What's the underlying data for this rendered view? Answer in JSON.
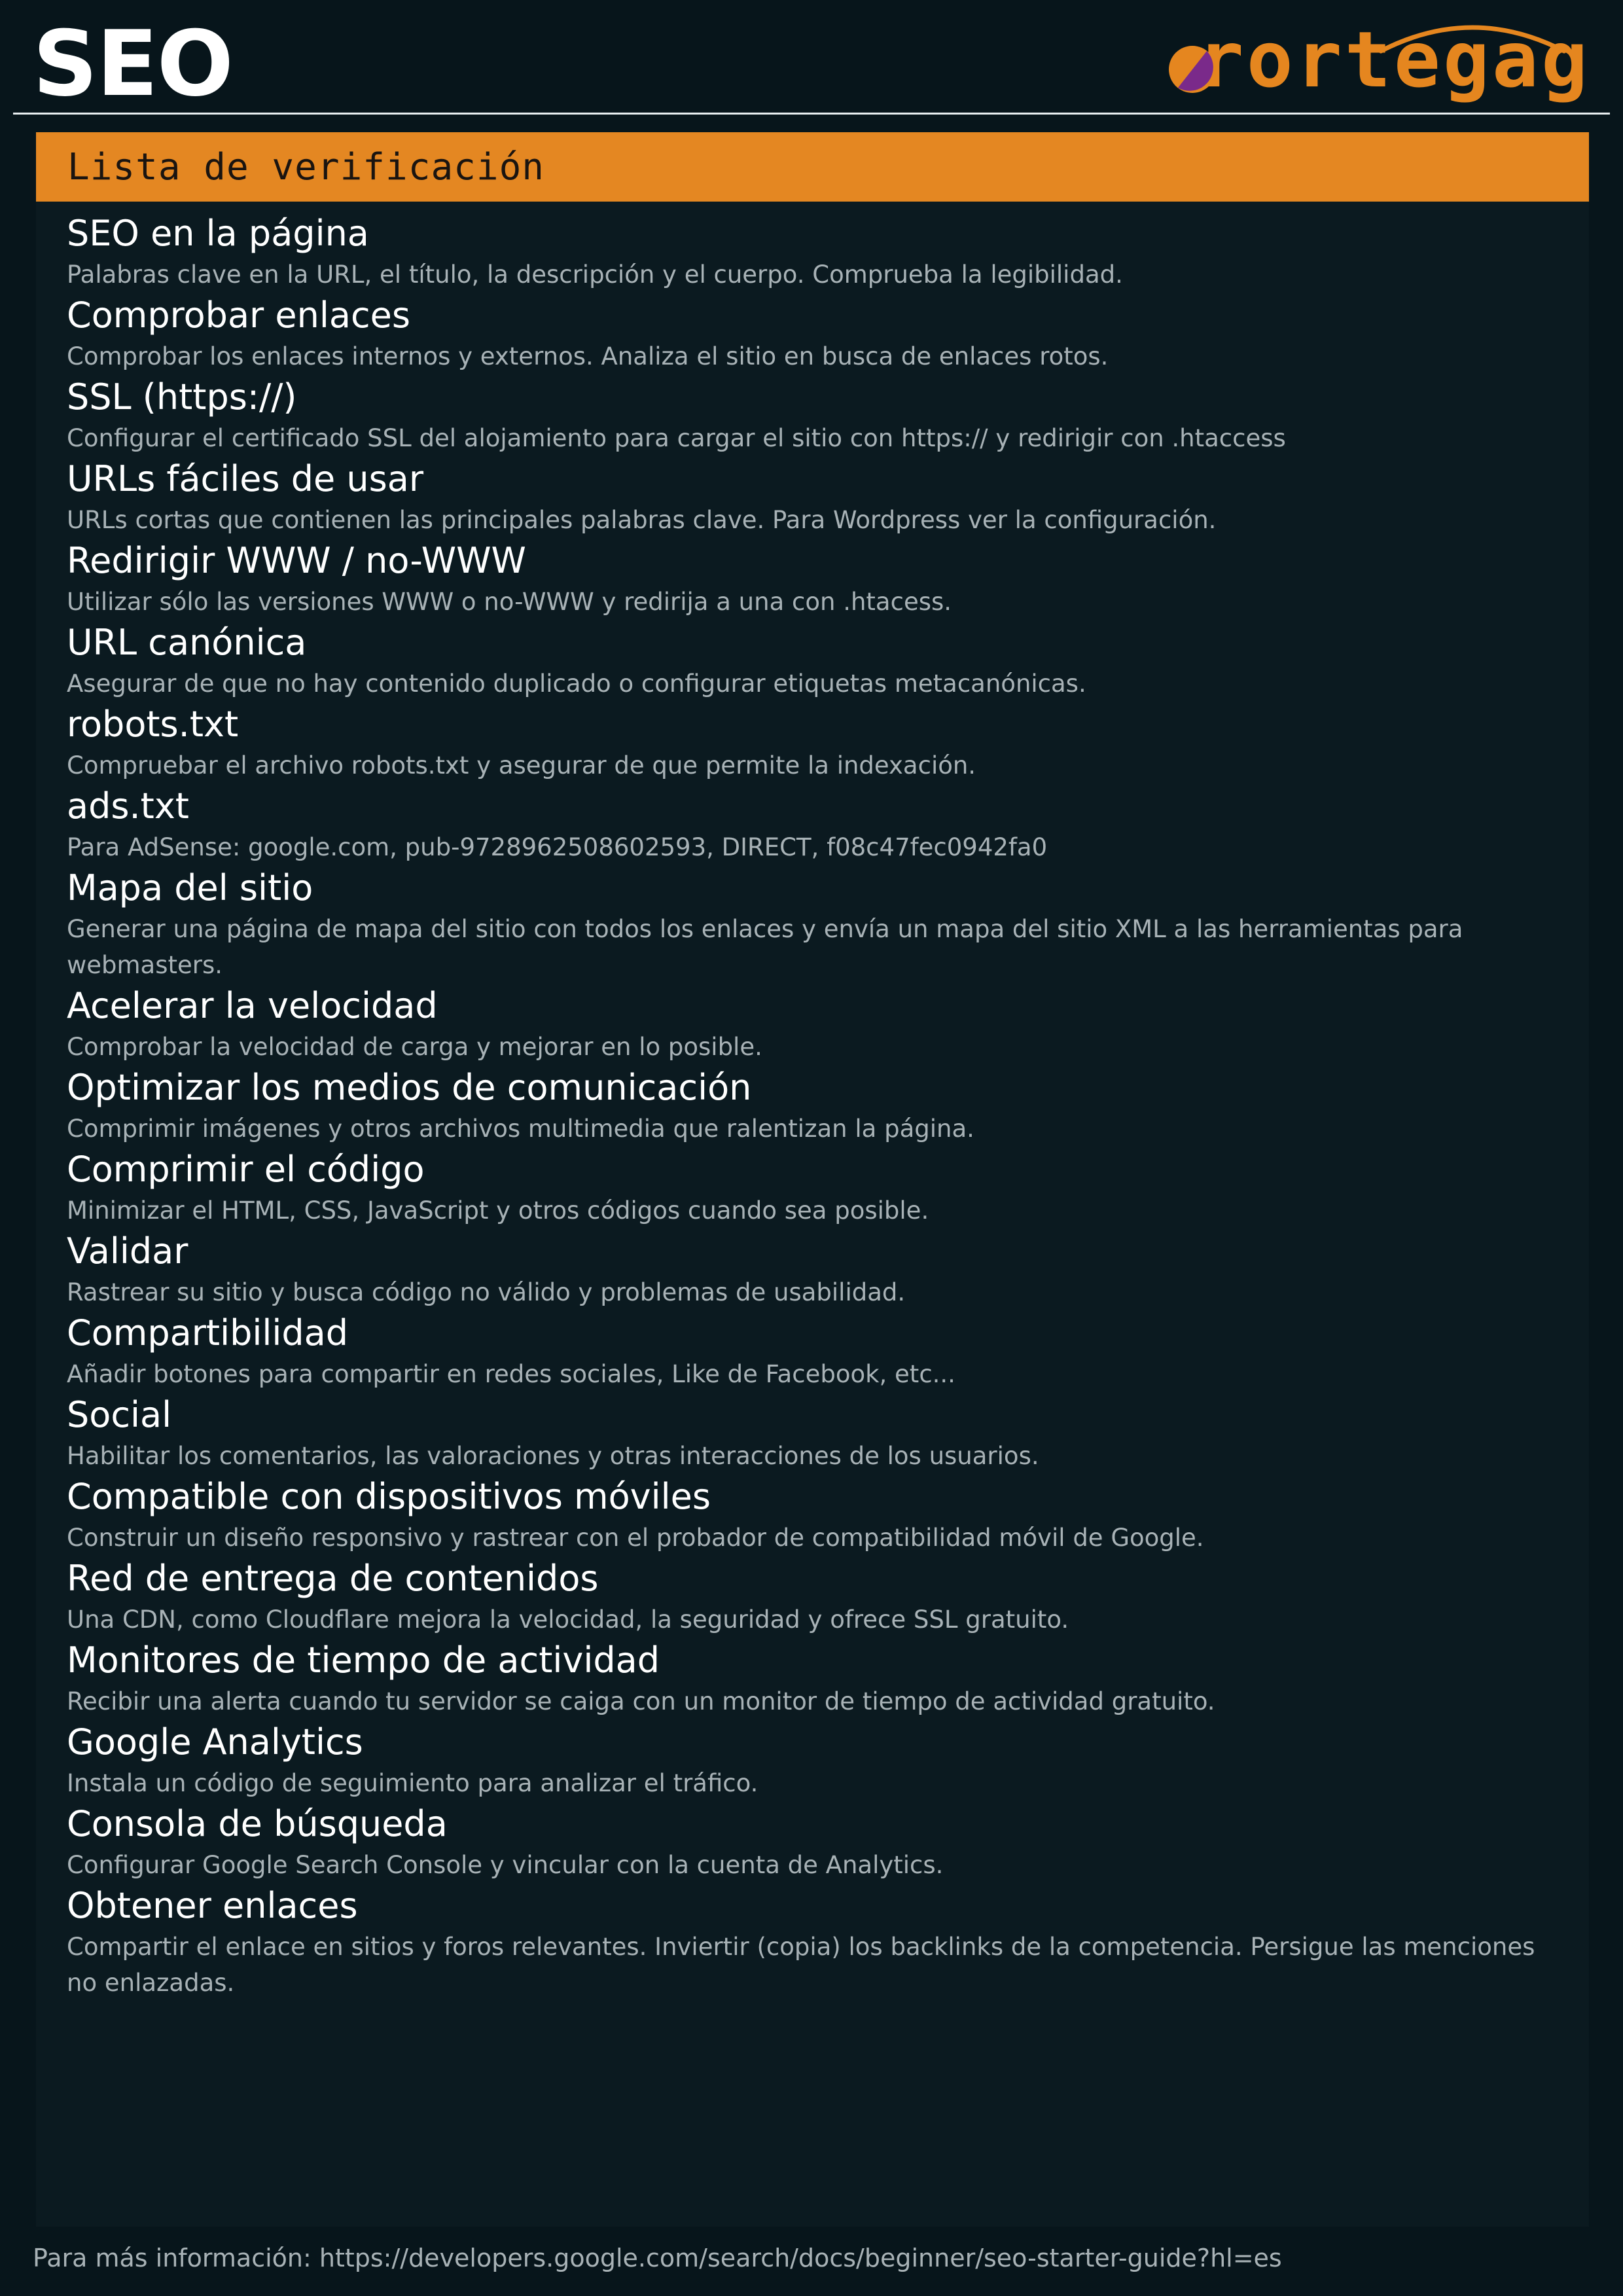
{
  "header": {
    "title": "SEO",
    "logo_text": "rortegag"
  },
  "panel": {
    "heading": "Lista de verificación",
    "items": [
      {
        "title": "SEO en la página",
        "desc": "Palabras clave en la URL, el título, la descripción y el cuerpo. Comprueba la legibilidad."
      },
      {
        "title": "Comprobar enlaces",
        "desc": "Comprobar los enlaces internos y externos. Analiza el sitio en busca de enlaces rotos."
      },
      {
        "title": "SSL (https://)",
        "desc": "Configurar el certificado SSL del alojamiento para cargar el sitio con https:// y redirigir con .htaccess"
      },
      {
        "title": "URLs fáciles de usar",
        "desc": "URLs cortas que contienen las principales palabras clave. Para Wordpress ver la configuración."
      },
      {
        "title": "Redirigir WWW / no-WWW",
        "desc": "Utilizar sólo las versiones WWW o no-WWW y redirija a una con .htacess."
      },
      {
        "title": "URL canónica",
        "desc": "Asegurar de que no hay contenido duplicado o configurar etiquetas metacanónicas."
      },
      {
        "title": "robots.txt",
        "desc": "Compruebar el archivo robots.txt y asegurar de que permite la indexación."
      },
      {
        "title": "ads.txt",
        "desc": "Para AdSense: google.com, pub-9728962508602593, DIRECT, f08c47fec0942fa0"
      },
      {
        "title": "Mapa del sitio",
        "desc": "Generar una página de mapa del sitio con todos los enlaces y envía un mapa del sitio XML a las herramientas para webmasters."
      },
      {
        "title": "Acelerar la velocidad",
        "desc": "Comprobar la velocidad de carga y mejorar en lo posible."
      },
      {
        "title": "Optimizar los medios de comunicación",
        "desc": "Comprimir imágenes y otros archivos multimedia que ralentizan la página."
      },
      {
        "title": "Comprimir el código",
        "desc": "Minimizar el HTML, CSS, JavaScript y otros códigos cuando sea posible."
      },
      {
        "title": "Validar",
        "desc": "Rastrear su sitio y busca código no válido y problemas de usabilidad."
      },
      {
        "title": "Compartibilidad",
        "desc": "Añadir botones para compartir en redes sociales, Like de Facebook, etc..."
      },
      {
        "title": "Social",
        "desc": "Habilitar los comentarios, las valoraciones y otras interacciones de los usuarios."
      },
      {
        "title": "Compatible con dispositivos móviles",
        "desc": "Construir un diseño responsivo y rastrear con el probador de compatibilidad móvil de Google."
      },
      {
        "title": "Red de entrega de contenidos",
        "desc": "Una CDN, como Cloudflare mejora la velocidad, la seguridad y ofrece SSL gratuito."
      },
      {
        "title": "Monitores de tiempo de actividad",
        "desc": "Recibir una alerta cuando tu servidor se caiga con un monitor de tiempo de actividad gratuito."
      },
      {
        "title": "Google Analytics",
        "desc": "Instala un código de seguimiento para analizar el tráfico."
      },
      {
        "title": "Consola de búsqueda",
        "desc": "Configurar Google Search Console y vincular con la cuenta de Analytics."
      },
      {
        "title": "Obtener enlaces",
        "desc": "Compartir el enlace en sitios y foros relevantes. Inviertir (copia) los backlinks de la competencia. Persigue las menciones no enlazadas."
      }
    ]
  },
  "footer": {
    "text": "Para más información: https://developers.google.com/search/docs/beginner/seo-starter-guide?hl=es"
  },
  "colors": {
    "background": "#07151b",
    "panel": "#0b1a20",
    "accent": "#e48722",
    "logo_dot_purple": "#7a2a8a"
  }
}
